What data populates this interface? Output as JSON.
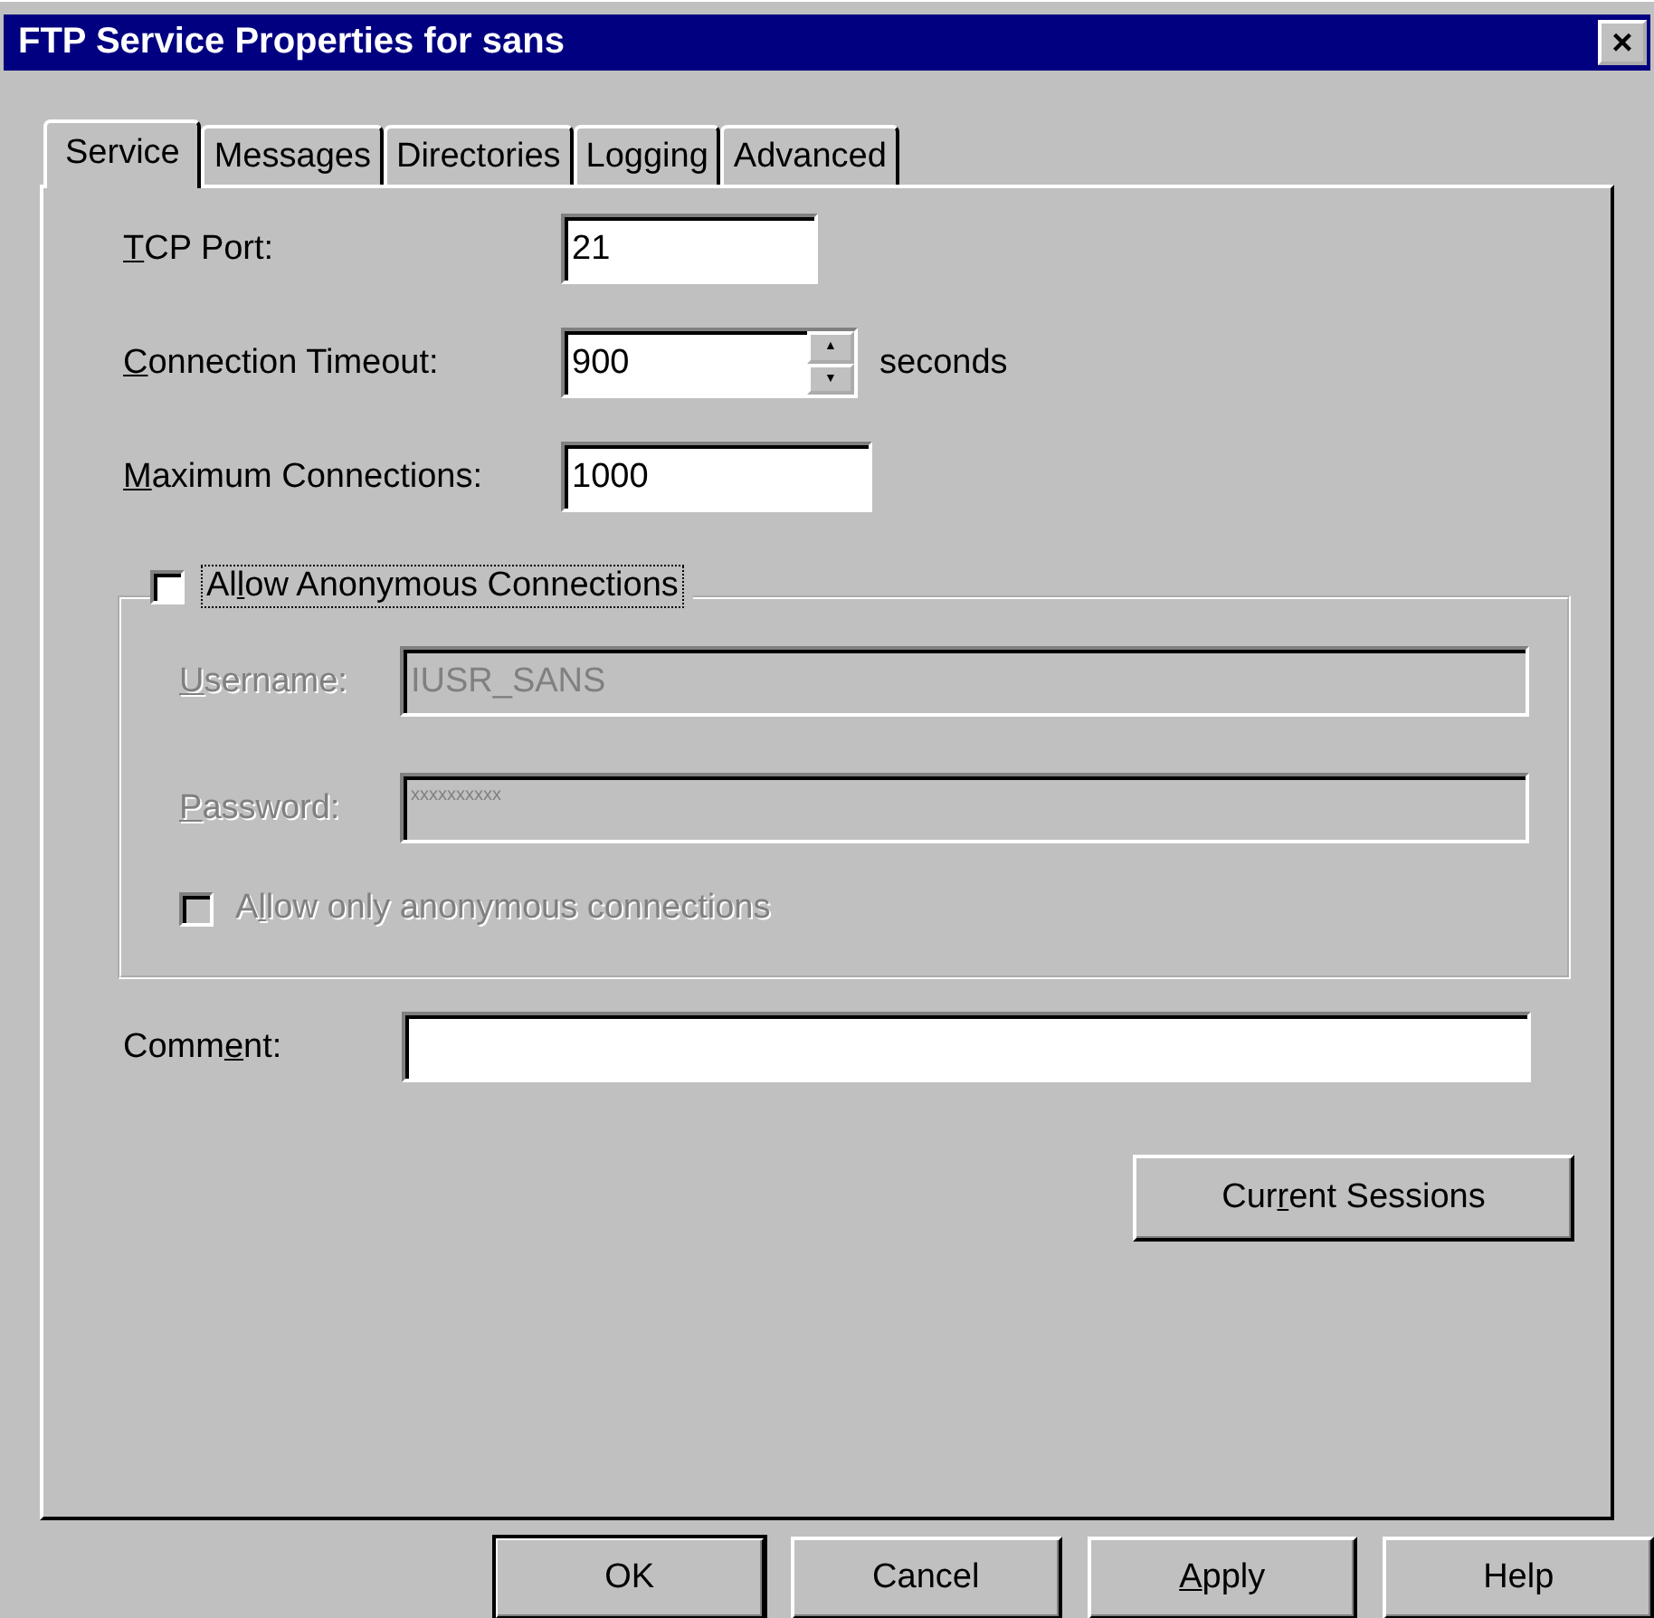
{
  "window": {
    "title": "FTP Service Properties for sans",
    "close": "×"
  },
  "tabs": [
    {
      "label": "Service",
      "selected": true
    },
    {
      "label": "Messages",
      "selected": false
    },
    {
      "label": "Directories",
      "selected": false
    },
    {
      "label": "Logging",
      "selected": false
    },
    {
      "label": "Advanced",
      "selected": false
    }
  ],
  "fields": [
    {
      "label": {
        "key": "T",
        "post": "CP Port:"
      },
      "value": "21",
      "spinner": false
    },
    {
      "label": {
        "key": "C",
        "post": "onnection Timeout:"
      },
      "value": "900",
      "spinner": true,
      "unit": "seconds",
      "up": "▲",
      "down": "▼"
    },
    {
      "label": {
        "key": "M",
        "post": "aximum Connections:"
      },
      "value": "1000",
      "spinner": false
    }
  ],
  "anonymous": {
    "label": {
      "pre": "Al",
      "key": "l",
      "post": "ow Anonymous Connections"
    },
    "checked": false,
    "focused": true,
    "username": {
      "label": {
        "key": "U",
        "post": "sername:"
      },
      "value": "IUSR_SANS",
      "disabled": true
    },
    "password": {
      "label": {
        "key": "P",
        "post": "assword:"
      },
      "value": "xxxxxxxxxx",
      "disabled": true
    },
    "only_anonymous": {
      "label": {
        "pre": "A",
        "key": "l",
        "post": "low only anonymous connections"
      },
      "checked": false,
      "disabled": true
    }
  },
  "comment": {
    "label": {
      "pre": "Comm",
      "key": "e",
      "post": "nt:"
    }
  },
  "sessions_button": {
    "pre": "Cur",
    "key": "r",
    "post": "ent Sessions"
  },
  "buttons": [
    {
      "post": "OK",
      "default": true
    },
    {
      "post": "Cancel",
      "default": false
    },
    {
      "key": "A",
      "post": "pply",
      "default": false
    },
    {
      "post": "Help",
      "default": false
    }
  ]
}
